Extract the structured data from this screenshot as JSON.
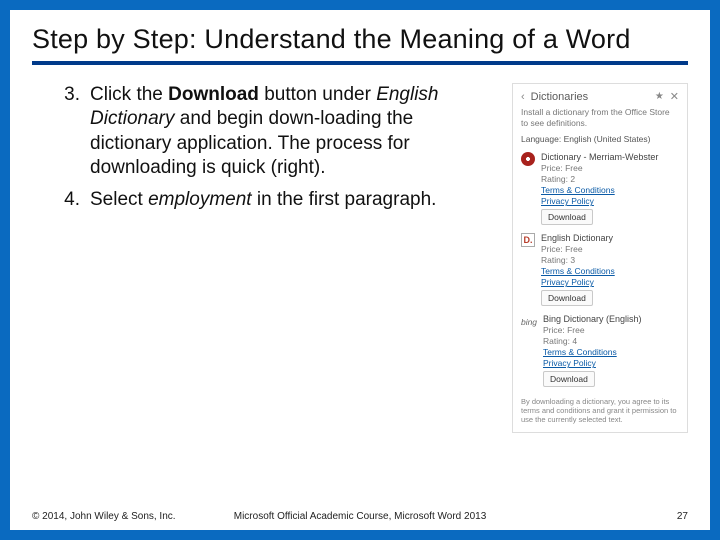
{
  "title": "Step by Step: Understand the Meaning of a Word",
  "steps": [
    {
      "num": "3.",
      "html": "Click the <b>Download</b> button under <i>English Dictionary</i> and begin down-loading the dictionary application. The process for downloading is quick (right)."
    },
    {
      "num": "4.",
      "html": "Select <i>employment</i> in the first paragraph."
    }
  ],
  "panel": {
    "title": "Dictionaries",
    "subtitle": "Install a dictionary from the Office Store to see definitions.",
    "lang_label": "Language:",
    "lang_value": "English (United States)",
    "entries": [
      {
        "icon": "mw",
        "name": "Dictionary - Merriam-Webster",
        "price": "Free",
        "rating": "2",
        "terms": "Terms & Conditions",
        "privacy": "Privacy Policy",
        "download": "Download"
      },
      {
        "icon": "engdict",
        "name": "English Dictionary",
        "price": "Free",
        "rating": "3",
        "terms": "Terms & Conditions",
        "privacy": "Privacy Policy",
        "download": "Download"
      },
      {
        "icon": "bing",
        "name": "Bing Dictionary (English)",
        "price": "Free",
        "rating": "4",
        "terms": "Terms & Conditions",
        "privacy": "Privacy Policy",
        "download": "Download"
      }
    ],
    "agreement": "By downloading a dictionary, you agree to its terms and conditions and grant it permission to use the currently selected text.",
    "price_label": "Price:",
    "rating_label": "Rating:"
  },
  "footer": {
    "copyright": "© 2014, John Wiley & Sons, Inc.",
    "center": "Microsoft Official Academic Course, Microsoft Word 2013",
    "page": "27"
  }
}
